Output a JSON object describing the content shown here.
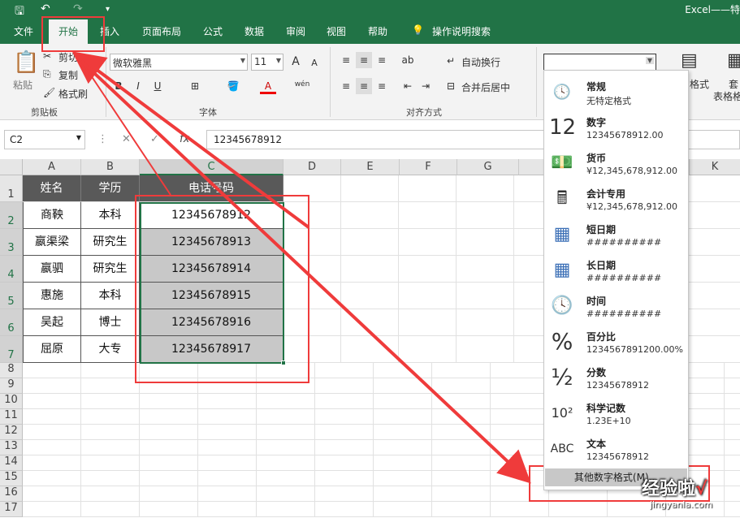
{
  "window": {
    "title": "Excel——特"
  },
  "qat": {
    "save": "🖫",
    "undo": "↶",
    "redo": "↷",
    "more": "▾"
  },
  "tabs": [
    "文件",
    "开始",
    "插入",
    "页面布局",
    "公式",
    "数据",
    "审阅",
    "视图",
    "帮助"
  ],
  "tell_me": "操作说明搜索",
  "ribbon": {
    "clipboard": {
      "paste": "粘贴",
      "cut": "剪切",
      "copy": "复制",
      "format_painter": "格式刷",
      "label": "剪贴板"
    },
    "font": {
      "name": "微软雅黑",
      "size": "11",
      "label": "字体",
      "bold": "B",
      "italic": "I",
      "underline": "U",
      "grow": "A",
      "shrink": "A",
      "phonetic": "wén"
    },
    "alignment": {
      "wrap": "自动换行",
      "merge": "合并后居中",
      "label": "对齐方式"
    },
    "number": {
      "format_value": ""
    },
    "styles": {
      "cond": "格式",
      "table": "套",
      "table2": "表格格"
    }
  },
  "formula_bar": {
    "name_box": "C2",
    "fx": "fx",
    "value": "12345678912"
  },
  "sheet": {
    "columns": [
      "A",
      "B",
      "C",
      "D",
      "E",
      "F",
      "G",
      "",
      "K"
    ],
    "rows": [
      "1",
      "2",
      "3",
      "4",
      "5",
      "6",
      "7",
      "8",
      "9",
      "10",
      "11",
      "12",
      "13",
      "14",
      "15",
      "16",
      "17"
    ],
    "headers": [
      "姓名",
      "学历",
      "电话号码"
    ],
    "data": [
      [
        "商鞅",
        "本科",
        "12345678912"
      ],
      [
        "嬴渠梁",
        "研究生",
        "12345678913"
      ],
      [
        "嬴驷",
        "研究生",
        "12345678914"
      ],
      [
        "惠施",
        "本科",
        "12345678915"
      ],
      [
        "吴起",
        "博士",
        "12345678916"
      ],
      [
        "屈原",
        "大专",
        "12345678917"
      ]
    ]
  },
  "number_formats": [
    {
      "icon": "clock-123-icon",
      "glyph": "🕓",
      "title": "常规",
      "value": "无特定格式"
    },
    {
      "icon": "number-12-icon",
      "glyph": "12",
      "title": "数字",
      "value": "12345678912.00"
    },
    {
      "icon": "currency-icon",
      "glyph": "💵",
      "title": "货币",
      "value": "¥12,345,678,912.00"
    },
    {
      "icon": "calculator-icon",
      "glyph": "🖩",
      "title": "会计专用",
      "value": " ¥12,345,678,912.00"
    },
    {
      "icon": "calendar-icon",
      "glyph": "▦",
      "title": "短日期",
      "value": "##########"
    },
    {
      "icon": "calendar-icon",
      "glyph": "▦",
      "title": "长日期",
      "value": "##########"
    },
    {
      "icon": "clock-icon",
      "glyph": "🕓",
      "title": "时间",
      "value": "##########"
    },
    {
      "icon": "percent-icon",
      "glyph": "%",
      "title": "百分比",
      "value": "1234567891200.00%"
    },
    {
      "icon": "fraction-icon",
      "glyph": "½",
      "title": "分数",
      "value": "12345678912"
    },
    {
      "icon": "scientific-icon",
      "glyph": "10²",
      "title": "科学记数",
      "value": "1.23E+10"
    },
    {
      "icon": "abc-icon",
      "glyph": "ABC",
      "title": "文本",
      "value": "12345678912"
    }
  ],
  "more_formats": "其他数字格式(M)...",
  "watermark": {
    "text": "经验啦",
    "check": "√",
    "url": "jingyanla.com"
  },
  "colors": {
    "excel_green": "#217346",
    "annotation_red": "#ef3b3b",
    "header_fill": "#595959",
    "selection_fill": "#c8c8c8"
  }
}
